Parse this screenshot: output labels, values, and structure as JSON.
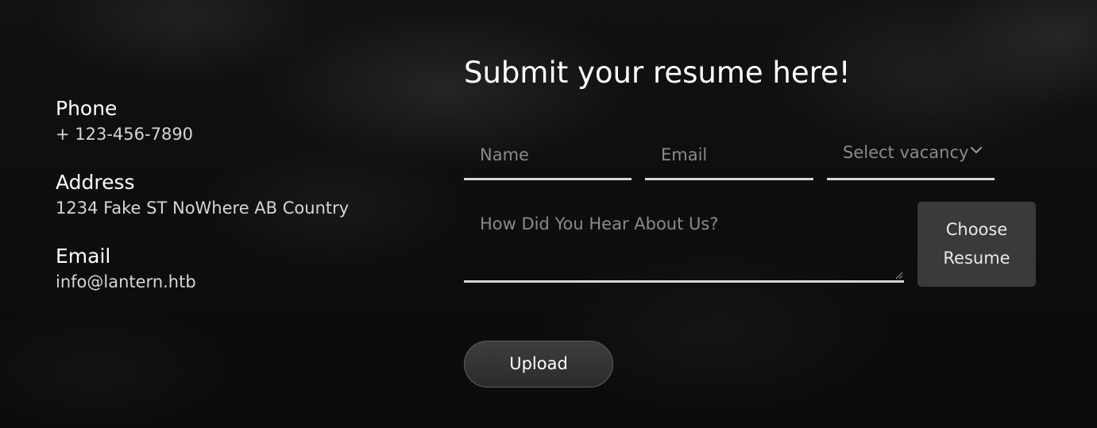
{
  "contact": {
    "phone": {
      "label": "Phone",
      "value": "+ 123-456-7890"
    },
    "address": {
      "label": "Address",
      "value": "1234 Fake ST NoWhere AB Country"
    },
    "email": {
      "label": "Email",
      "value": "info@lantern.htb"
    }
  },
  "form": {
    "title": "Submit your resume here!",
    "name_placeholder": "Name",
    "email_placeholder": "Email",
    "vacancy_placeholder": "Select vacancy",
    "hear_about_placeholder": "How Did You Hear About Us?",
    "choose_resume_line1": "Choose",
    "choose_resume_line2": "Resume",
    "upload_label": "Upload"
  },
  "icons": {
    "vacancy_dropdown": "chevron-down-icon",
    "textarea_resize": "resize-grip-icon"
  },
  "colors": {
    "background": "#0d0d0d",
    "field_underline": "#d7d7d7",
    "placeholder": "#8a8a8a",
    "button_bg": "#3a3a3a"
  }
}
